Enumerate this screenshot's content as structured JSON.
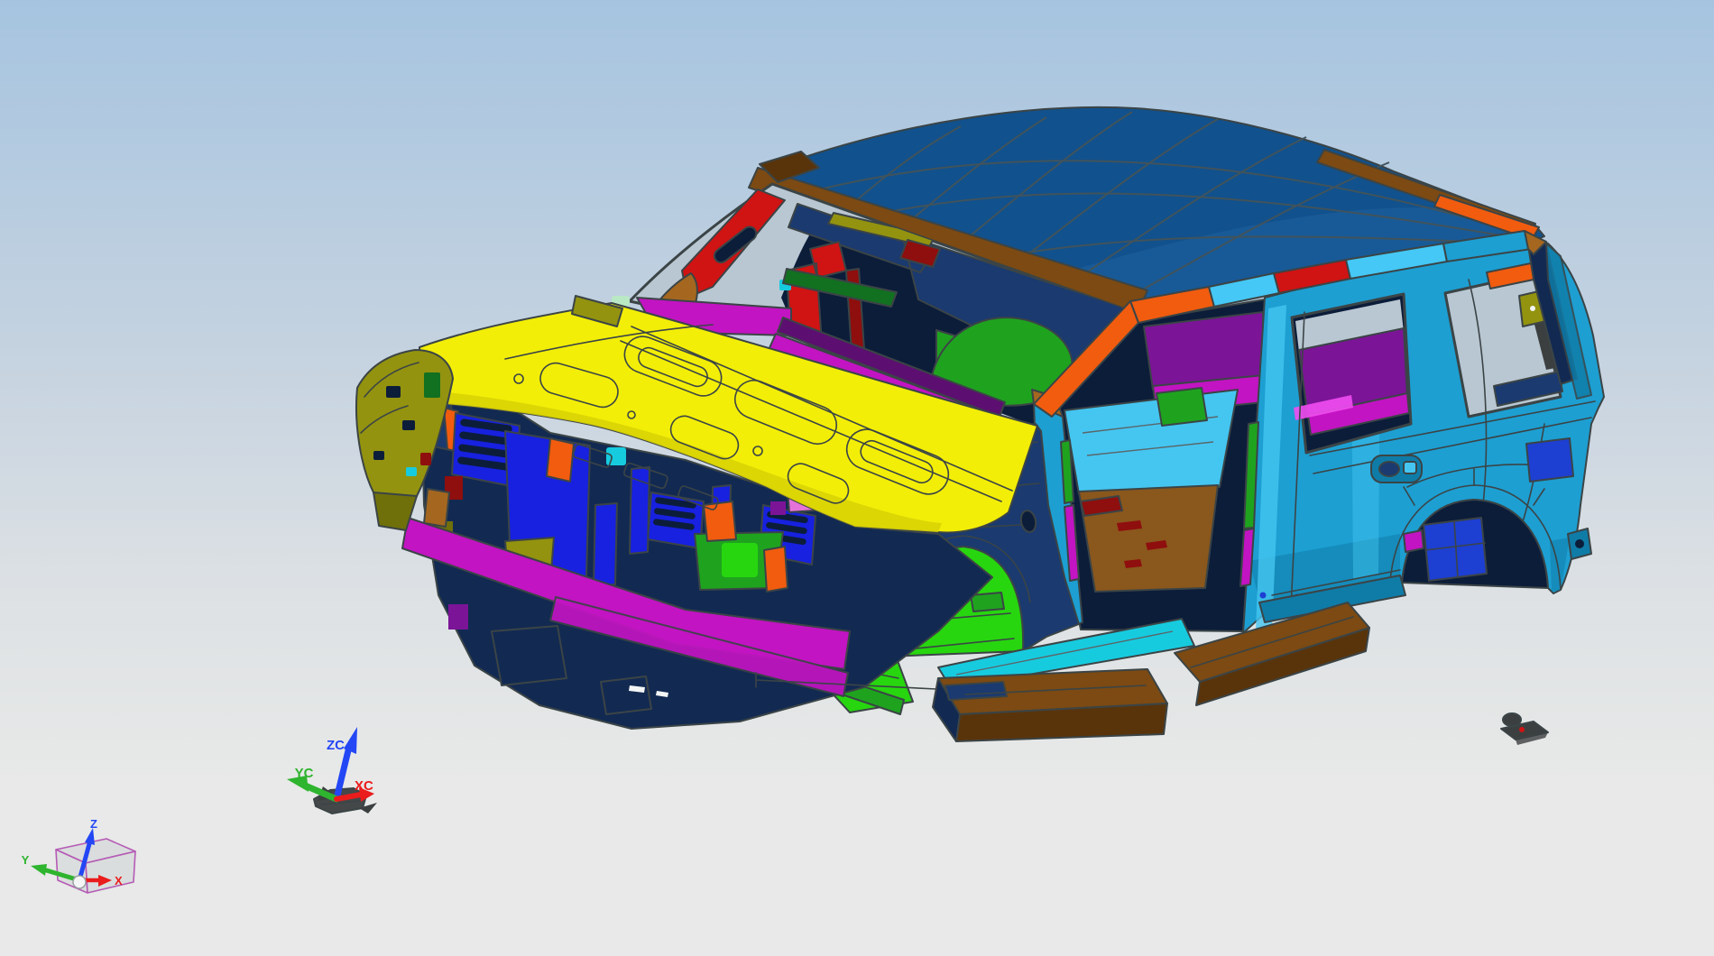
{
  "viewport": {
    "type": "cad-3d-viewport",
    "model_description": "SUV body-in-white multi-colored sheet metal assembly, front three-quarter isometric view"
  },
  "wcs_triad": {
    "z_label": "ZC",
    "y_label": "YC",
    "x_label": "XC"
  },
  "datum_csys": {
    "z_label": "Z",
    "y_label": "Y",
    "x_label": "X"
  },
  "palette": {
    "bg-top": "#a6c4e0",
    "bg-mid": "#c6d3e0",
    "bg-low": "#dde1e4",
    "bg-bottom": "#e8e9e8",
    "edge": "#3b4446",
    "edge-soft": "#5a666a",
    "window-bg": "#b9c7d2",
    "roof": "#11518d",
    "roof-light": "#2a6fb0",
    "roof-line": "#41535b",
    "brown": "#7c4a12",
    "brown-dark": "#59340b",
    "brown-floor": "#8a571c",
    "copper": "#a5671f",
    "hood": "#f2ee07",
    "hood-shade": "#d9d305",
    "olive": "#93930f",
    "olive-dark": "#70700a",
    "mint": "#b9e8c4",
    "red": "#d01313",
    "red-dark": "#8f0e0e",
    "orange": "#f15c0f",
    "magenta": "#c214c2",
    "magenta-bright": "#f24df2",
    "purple": "#7c1497",
    "cowl-purple": "#5c0f70",
    "cyan": "#1d9fd2",
    "cyan-light": "#45c6f1",
    "cyan-dark": "#0f7ca8",
    "sky-rail": "#45c8f5",
    "teal": "#17cbdf",
    "navy": "#1a3a70",
    "navy-dark": "#122a52",
    "navy-deep": "#0c1d3a",
    "blue": "#1721df",
    "royal": "#1d3fd2",
    "green-bright": "#27d60f",
    "green": "#1fa31f",
    "green-dark": "#127021",
    "green-hi": "#8ef08e",
    "pink": "#e673d9",
    "white": "#f3f5f5",
    "gray-part": "#3c3f40",
    "tri-blue": "#2347f5",
    "tri-green": "#2eb42e",
    "tri-red": "#ea1c1c",
    "csys-edge": "#b55ab5",
    "csys-face": "#d6d8da",
    "sphere-hi": "#f4f6f6",
    "sphere-sh": "#9aa0a3"
  },
  "parts": [
    {
      "name": "roof-panel",
      "color": "roof"
    },
    {
      "name": "windshield-header-rail",
      "color": "brown"
    },
    {
      "name": "hood-panel",
      "color": "hood"
    },
    {
      "name": "front-fender",
      "color": "navy"
    },
    {
      "name": "fender-tip-left",
      "color": "olive"
    },
    {
      "name": "a-pillar-inner",
      "color": "red"
    },
    {
      "name": "a-pillar-reinforcement",
      "color": "orange"
    },
    {
      "name": "cowl-panel",
      "color": "magenta"
    },
    {
      "name": "body-side-outer",
      "color": "cyan"
    },
    {
      "name": "roof-side-rail",
      "color": "sky-rail"
    },
    {
      "name": "radiator-grille-support",
      "color": "blue"
    },
    {
      "name": "bumper-crossmember",
      "color": "magenta"
    },
    {
      "name": "front-floor",
      "color": "green-bright"
    },
    {
      "name": "rear-floor",
      "color": "brown-floor"
    },
    {
      "name": "rocker-running-boards",
      "color": "brown"
    },
    {
      "name": "seat-structure",
      "color": "green"
    },
    {
      "name": "interior-trim-panels",
      "color": "purple"
    },
    {
      "name": "wheelhouse-bracket",
      "color": "royal"
    }
  ]
}
